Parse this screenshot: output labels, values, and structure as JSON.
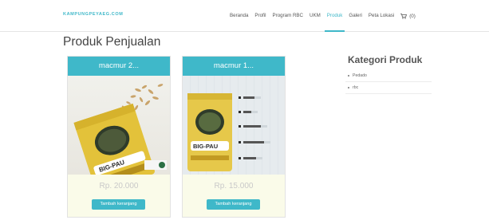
{
  "navbar": {
    "brand": "KAMPUNGPEYAEG.COM",
    "items": [
      {
        "label": "Beranda"
      },
      {
        "label": "Profil"
      },
      {
        "label": "Program RBC"
      },
      {
        "label": "UKM"
      },
      {
        "label": "Produk",
        "active": true
      },
      {
        "label": "Galeri"
      },
      {
        "label": "Peta Lokasi"
      }
    ],
    "cart_count": "(0)"
  },
  "page": {
    "title": "Produk Penjualan"
  },
  "products": [
    {
      "name": "macmur 2...",
      "price": "Rp. 20.000",
      "button": "Tambah keranjang",
      "image_icon": "snack-package-image"
    },
    {
      "name": "macmur 1...",
      "price": "Rp. 15.000",
      "button": "Tambah keranjang",
      "image_icon": "snack-package-image"
    }
  ],
  "sidebar": {
    "title": "Kategori Produk",
    "categories": [
      {
        "label": "Pedado"
      },
      {
        "label": "rbc"
      }
    ]
  },
  "colors": {
    "accent": "#3fb8c9",
    "price_bg": "#fafbe9"
  }
}
